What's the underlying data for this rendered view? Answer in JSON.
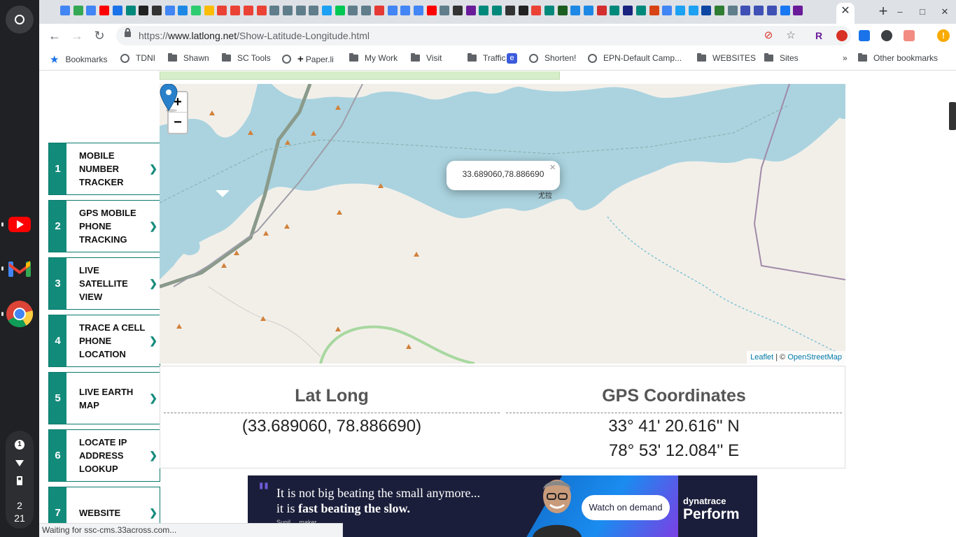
{
  "tabstrip": {
    "favicon_colors": [
      "#4285f4",
      "#34a853",
      "#4285f4",
      "#ff0000",
      "#1a73e8",
      "#00897b",
      "#212121",
      "#333",
      "#4285f4",
      "#1e88e5",
      "#2ecc71",
      "#fbbc05",
      "#ea4335",
      "#ea4335",
      "#ea4335",
      "#ea4335",
      "#607d8b",
      "#607d8b",
      "#607d8b",
      "#607d8b",
      "#1da1f2",
      "#00c853",
      "#607d8b",
      "#607d8b",
      "#e53935",
      "#4285f4",
      "#4285f4",
      "#4285f4",
      "#ff0000",
      "#607d8b",
      "#333",
      "#6a1b9a",
      "#00897b",
      "#00897b",
      "#333",
      "#212121",
      "#ea4335",
      "#00897b",
      "#1b5e20",
      "#1e88e5",
      "#1e88e5",
      "#d32f2f",
      "#00897b",
      "#1a237e",
      "#00897b",
      "#d84315",
      "#4285f4",
      "#1da1f2",
      "#1da1f2",
      "#0d47a1",
      "#2e7d32",
      "#607d8b",
      "#3f51b5",
      "#3f51b5",
      "#3f51b5",
      "#1877f2",
      "#6a1b9a"
    ],
    "close_label": "✕",
    "new_tab_label": "+"
  },
  "window_controls": {
    "minimize": "–",
    "maximize": "□",
    "close": "✕"
  },
  "toolbar": {
    "back": "←",
    "forward": "→",
    "reload": "↻",
    "url_scheme": "https://",
    "url_host": "www.latlong.net",
    "url_path": "/Show-Latitude-Longitude.html",
    "star": "☆",
    "update_label": "!"
  },
  "bookmarks": {
    "items": [
      {
        "label": "Bookmarks",
        "icon": "star-icon"
      },
      {
        "label": "TDNI",
        "icon": "globe-icon"
      },
      {
        "label": "Shawn",
        "icon": "folder-icon"
      },
      {
        "label": "SC Tools",
        "icon": "folder-icon"
      },
      {
        "label": "Paper.li",
        "icon": "globe-icon"
      },
      {
        "label": "My Work",
        "icon": "folder-icon"
      },
      {
        "label": "Visit",
        "icon": "folder-icon"
      },
      {
        "label": "Traffic",
        "icon": "folder-icon"
      },
      {
        "label": "",
        "icon": "e-icon"
      },
      {
        "label": "Shorten!",
        "icon": "globe-icon"
      },
      {
        "label": "EPN-Default Camp...",
        "icon": "globe-icon"
      },
      {
        "label": "WEBSITES",
        "icon": "folder-icon"
      },
      {
        "label": "Sites",
        "icon": "folder-icon"
      }
    ],
    "overflow": "»",
    "other": "Other bookmarks"
  },
  "sidebar": {
    "items": [
      {
        "num": "1",
        "label": "MOBILE NUMBER TRACKER"
      },
      {
        "num": "2",
        "label": "GPS MOBILE PHONE TRACKING"
      },
      {
        "num": "3",
        "label": "LIVE SATELLITE VIEW"
      },
      {
        "num": "4",
        "label": "TRACE A CELL PHONE LOCATION"
      },
      {
        "num": "5",
        "label": "LIVE EARTH MAP"
      },
      {
        "num": "6",
        "label": "LOCATE IP ADDRESS LOOKUP"
      },
      {
        "num": "7",
        "label": "WEBSITE"
      }
    ],
    "arrow": "❯"
  },
  "map": {
    "zoom_in": "+",
    "zoom_out": "−",
    "popup_text": "33.689060,78.886690",
    "popup_close": "×",
    "place_label": "尤拉",
    "attribution_leaflet": "Leaflet",
    "attribution_sep": " | © ",
    "attribution_osm": "OpenStreetMap"
  },
  "coords": {
    "latlong_heading": "Lat Long",
    "latlong_value": "(33.689060, 78.886690)",
    "gps_heading": "GPS Coordinates",
    "gps_lat": "33° 41' 20.616'' N",
    "gps_lon": "78° 53' 12.084'' E"
  },
  "ad": {
    "quote": "\"",
    "line1": "It is not big beating the small anymore...",
    "line2_prefix": "it is ",
    "line2_bold": "fast beating the slow.",
    "speaker": "Sunil ... maker",
    "cta": "Watch on demand",
    "brand": "dynatrace",
    "brand_sub": "Perform"
  },
  "shelf": {
    "notification_count": "1",
    "time_hour": "2",
    "time_min": "21"
  },
  "status": "Waiting for ssc-cms.33across.com..."
}
